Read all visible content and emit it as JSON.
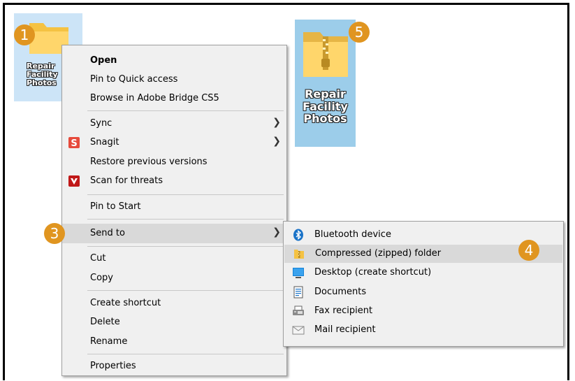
{
  "desktop": {
    "folder_label_top": "Repair Facility Photos",
    "zip_label": [
      "Repair",
      "Facility",
      "Photos"
    ],
    "folder_label_lines": [
      "Repair",
      "Facility",
      "Photos"
    ]
  },
  "badges": [
    "1",
    "3",
    "4",
    "5"
  ],
  "context_menu": {
    "open": "Open",
    "pin_quick": "Pin to Quick access",
    "browse_bridge": "Browse in Adobe Bridge CS5",
    "sync": "Sync",
    "snagit": "Snagit",
    "restore": "Restore previous versions",
    "scan": "Scan for threats",
    "pin_start": "Pin to Start",
    "send_to": "Send to",
    "cut": "Cut",
    "copy": "Copy",
    "create_shortcut": "Create shortcut",
    "delete": "Delete",
    "rename": "Rename",
    "properties": "Properties"
  },
  "send_to_menu": {
    "bluetooth": "Bluetooth device",
    "zip": "Compressed (zipped) folder",
    "desktop": "Desktop (create shortcut)",
    "documents": "Documents",
    "fax": "Fax recipient",
    "mail": "Mail recipient"
  },
  "colors": {
    "badge": "#e09520",
    "selection": "#cce4f7",
    "zip_selection": "#9ccdea",
    "highlight": "#d9d9d9"
  },
  "icons": {
    "snagit": "snagit-icon",
    "scan": "mcafee-icon",
    "bluetooth": "bluetooth-icon",
    "zip": "zip-folder-icon",
    "desktop": "desktop-icon",
    "documents": "documents-icon",
    "fax": "fax-icon",
    "mail": "mail-icon"
  }
}
